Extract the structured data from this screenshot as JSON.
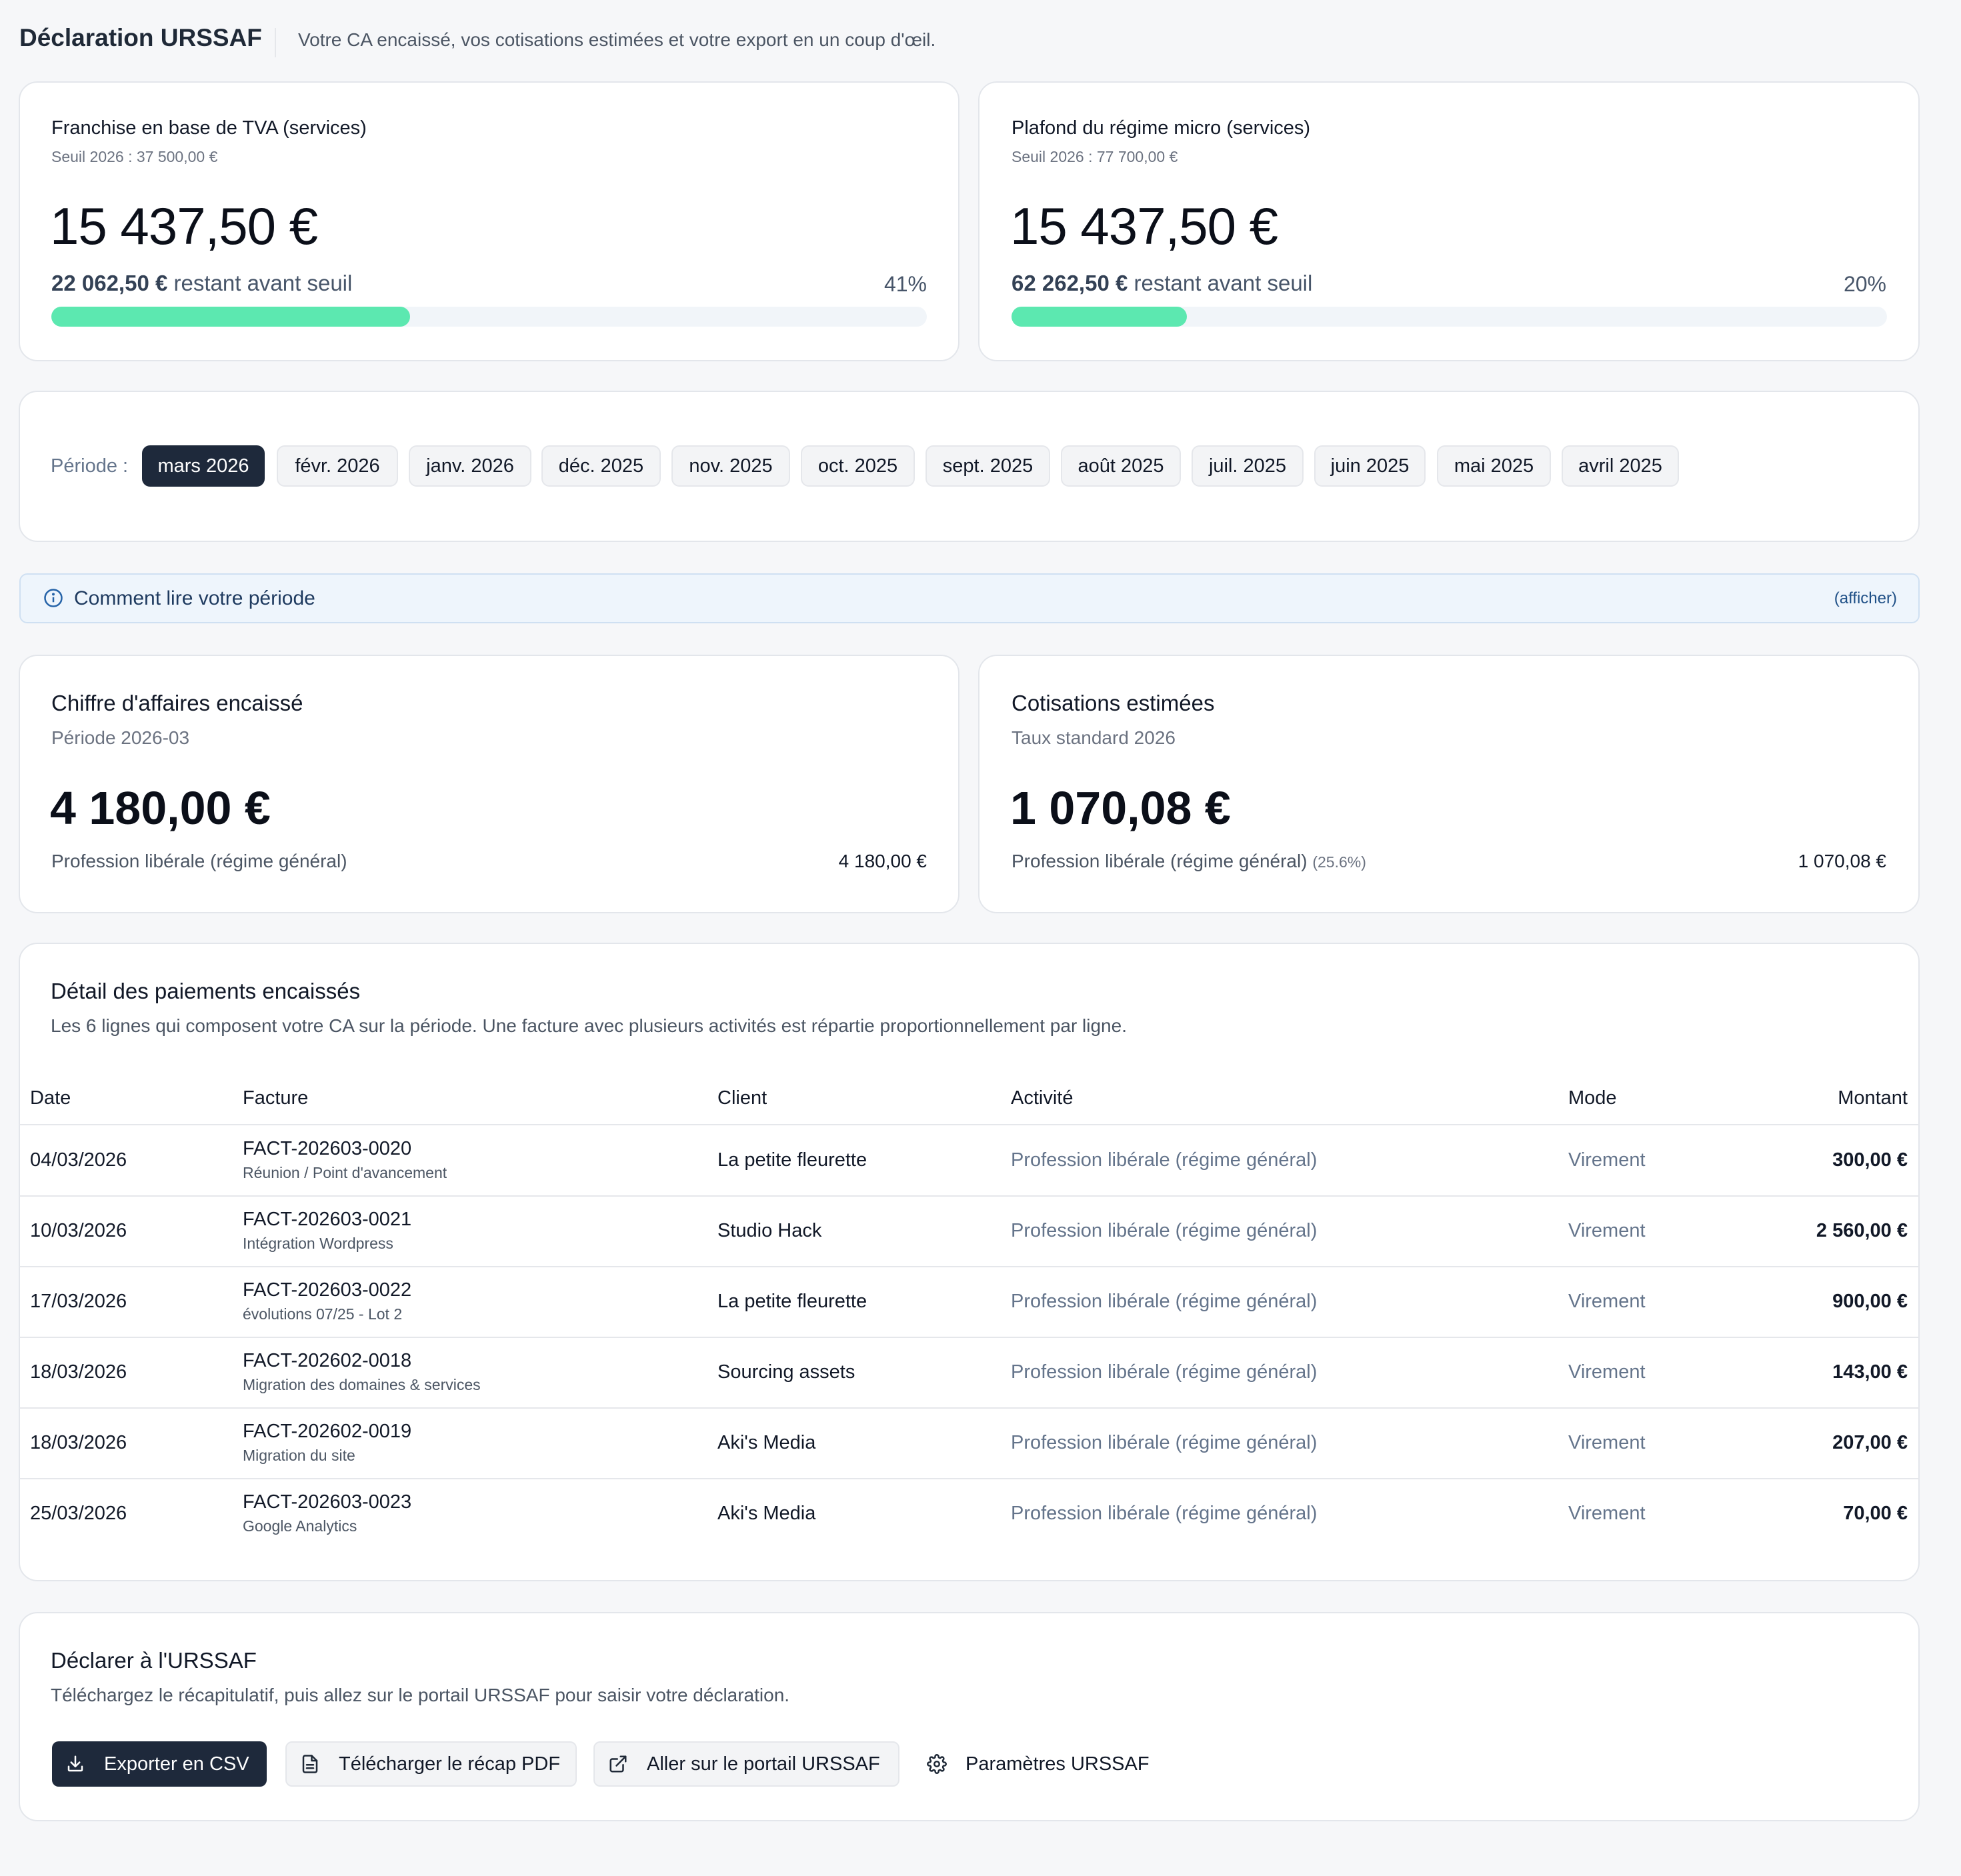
{
  "header": {
    "title": "Déclaration URSSAF",
    "subtitle": "Votre CA encaissé, vos cotisations estimées et votre export en un coup d'œil."
  },
  "thresholds": [
    {
      "title": "Franchise en base de TVA (services)",
      "seuil": "Seuil 2026 : 37 500,00 €",
      "amount": "15 437,50 €",
      "remaining_value": "22 062,50 €",
      "remaining_label": "restant avant seuil",
      "percent_label": "41%",
      "progress": 0.41
    },
    {
      "title": "Plafond du régime micro (services)",
      "seuil": "Seuil 2026 : 77 700,00 €",
      "amount": "15 437,50 €",
      "remaining_value": "62 262,50 €",
      "remaining_label": "restant avant seuil",
      "percent_label": "20%",
      "progress": 0.2
    }
  ],
  "period": {
    "label": "Période :",
    "selected": "mars 2026",
    "options": [
      "mars 2026",
      "févr. 2026",
      "janv. 2026",
      "déc. 2025",
      "nov. 2025",
      "oct. 2025",
      "sept. 2025",
      "août 2025",
      "juil. 2025",
      "juin 2025",
      "mai 2025",
      "avril 2025"
    ]
  },
  "info": {
    "text": "Comment lire votre période",
    "toggle": "(afficher)"
  },
  "stats": [
    {
      "title": "Chiffre d'affaires encaissé",
      "subtitle": "Période 2026-03",
      "amount": "4 180,00 €",
      "line_label": "Profession libérale (régime général)",
      "line_rate": "",
      "line_value": "4 180,00 €"
    },
    {
      "title": "Cotisations estimées",
      "subtitle": "Taux standard 2026",
      "amount": "1 070,08 €",
      "line_label": "Profession libérale (régime général)",
      "line_rate": "(25.6%)",
      "line_value": "1 070,08 €"
    }
  ],
  "detail": {
    "title": "Détail des paiements encaissés",
    "subtitle": "Les 6 lignes qui composent votre CA sur la période. Une facture avec plusieurs activités est répartie proportionnellement par ligne.",
    "columns": [
      "Date",
      "Facture",
      "Client",
      "Activité",
      "Mode",
      "Montant"
    ],
    "rows": [
      {
        "date": "04/03/2026",
        "invoice": "FACT-202603-0020",
        "desc": "Réunion / Point d'avancement",
        "client": "La petite fleurette",
        "activity": "Profession libérale (régime général)",
        "mode": "Virement",
        "amount": "300,00 €"
      },
      {
        "date": "10/03/2026",
        "invoice": "FACT-202603-0021",
        "desc": "Intégration Wordpress",
        "client": "Studio Hack",
        "activity": "Profession libérale (régime général)",
        "mode": "Virement",
        "amount": "2 560,00 €"
      },
      {
        "date": "17/03/2026",
        "invoice": "FACT-202603-0022",
        "desc": "évolutions 07/25 - Lot 2",
        "client": "La petite fleurette",
        "activity": "Profession libérale (régime général)",
        "mode": "Virement",
        "amount": "900,00 €"
      },
      {
        "date": "18/03/2026",
        "invoice": "FACT-202602-0018",
        "desc": "Migration des domaines & services",
        "client": "Sourcing assets",
        "activity": "Profession libérale (régime général)",
        "mode": "Virement",
        "amount": "143,00 €"
      },
      {
        "date": "18/03/2026",
        "invoice": "FACT-202602-0019",
        "desc": "Migration du site",
        "client": "Aki's Media",
        "activity": "Profession libérale (régime général)",
        "mode": "Virement",
        "amount": "207,00 €"
      },
      {
        "date": "25/03/2026",
        "invoice": "FACT-202603-0023",
        "desc": "Google Analytics",
        "client": "Aki's Media",
        "activity": "Profession libérale (régime général)",
        "mode": "Virement",
        "amount": "70,00 €"
      }
    ]
  },
  "declare": {
    "title": "Déclarer à l'URSSAF",
    "subtitle": "Téléchargez le récapitulatif, puis allez sur le portail URSSAF pour saisir votre déclaration.",
    "buttons": {
      "export_csv": "Exporter en CSV",
      "pdf": "Télécharger le récap PDF",
      "portal": "Aller sur le portail URSSAF",
      "settings": "Paramètres URSSAF"
    }
  },
  "colors": {
    "accent_dark": "#1e293b",
    "progress_fill": "#5ce8b0",
    "info_bg": "#eef5fc",
    "page_bg": "#f6f7f9"
  }
}
